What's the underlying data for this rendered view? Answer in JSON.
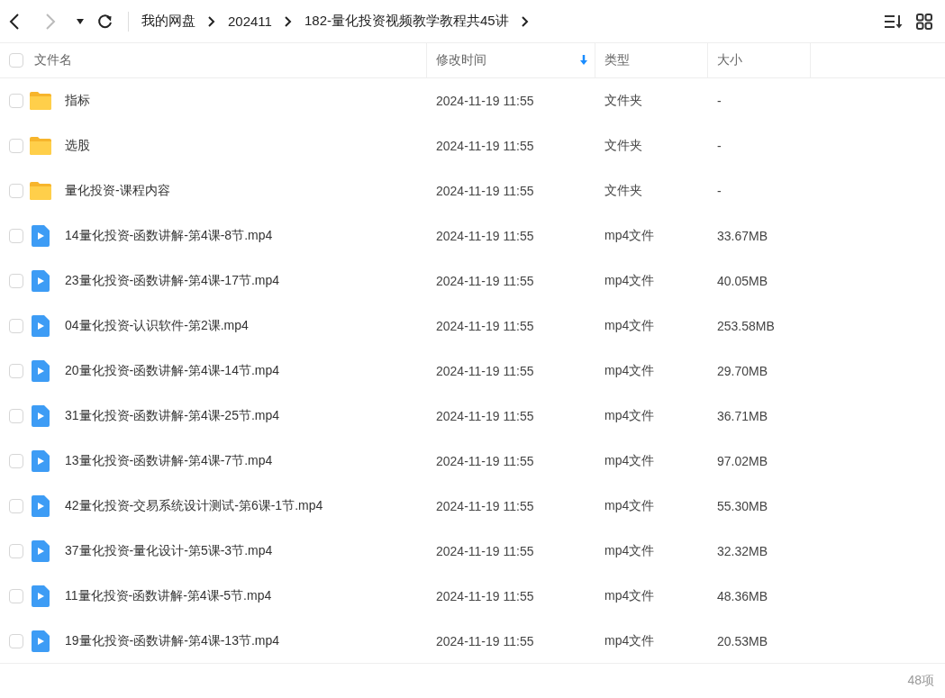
{
  "toolbar": {
    "back_disabled": false,
    "forward_disabled": true,
    "breadcrumb": [
      "我的网盘",
      "202411",
      "182-量化投资视频教学教程共45讲"
    ]
  },
  "table": {
    "select_all_checked": false,
    "columns": [
      {
        "label": "文件名",
        "sorted": false
      },
      {
        "label": "修改时间",
        "sorted": true
      },
      {
        "label": "类型",
        "sorted": false
      },
      {
        "label": "大小",
        "sorted": false
      }
    ],
    "rows": [
      {
        "kind": "folder",
        "checked": false,
        "name": "指标",
        "modified": "2024-11-19 11:55",
        "type": "文件夹",
        "size": "-"
      },
      {
        "kind": "folder",
        "checked": false,
        "name": "选股",
        "modified": "2024-11-19 11:55",
        "type": "文件夹",
        "size": "-"
      },
      {
        "kind": "folder",
        "checked": false,
        "name": "量化投资-课程内容",
        "modified": "2024-11-19 11:55",
        "type": "文件夹",
        "size": "-"
      },
      {
        "kind": "video",
        "checked": false,
        "name": "14量化投资-函数讲解-第4课-8节.mp4",
        "modified": "2024-11-19 11:55",
        "type": "mp4文件",
        "size": "33.67MB"
      },
      {
        "kind": "video",
        "checked": false,
        "name": "23量化投资-函数讲解-第4课-17节.mp4",
        "modified": "2024-11-19 11:55",
        "type": "mp4文件",
        "size": "40.05MB"
      },
      {
        "kind": "video",
        "checked": false,
        "name": "04量化投资-认识软件-第2课.mp4",
        "modified": "2024-11-19 11:55",
        "type": "mp4文件",
        "size": "253.58MB"
      },
      {
        "kind": "video",
        "checked": false,
        "name": "20量化投资-函数讲解-第4课-14节.mp4",
        "modified": "2024-11-19 11:55",
        "type": "mp4文件",
        "size": "29.70MB"
      },
      {
        "kind": "video",
        "checked": false,
        "name": "31量化投资-函数讲解-第4课-25节.mp4",
        "modified": "2024-11-19 11:55",
        "type": "mp4文件",
        "size": "36.71MB"
      },
      {
        "kind": "video",
        "checked": false,
        "name": "13量化投资-函数讲解-第4课-7节.mp4",
        "modified": "2024-11-19 11:55",
        "type": "mp4文件",
        "size": "97.02MB"
      },
      {
        "kind": "video",
        "checked": false,
        "name": "42量化投资-交易系统设计测试-第6课-1节.mp4",
        "modified": "2024-11-19 11:55",
        "type": "mp4文件",
        "size": "55.30MB"
      },
      {
        "kind": "video",
        "checked": false,
        "name": "37量化投资-量化设计-第5课-3节.mp4",
        "modified": "2024-11-19 11:55",
        "type": "mp4文件",
        "size": "32.32MB"
      },
      {
        "kind": "video",
        "checked": false,
        "name": "11量化投资-函数讲解-第4课-5节.mp4",
        "modified": "2024-11-19 11:55",
        "type": "mp4文件",
        "size": "48.36MB"
      },
      {
        "kind": "video",
        "checked": false,
        "name": "19量化投资-函数讲解-第4课-13节.mp4",
        "modified": "2024-11-19 11:55",
        "type": "mp4文件",
        "size": "20.53MB"
      }
    ]
  },
  "status_bar": {
    "count": "48项"
  }
}
